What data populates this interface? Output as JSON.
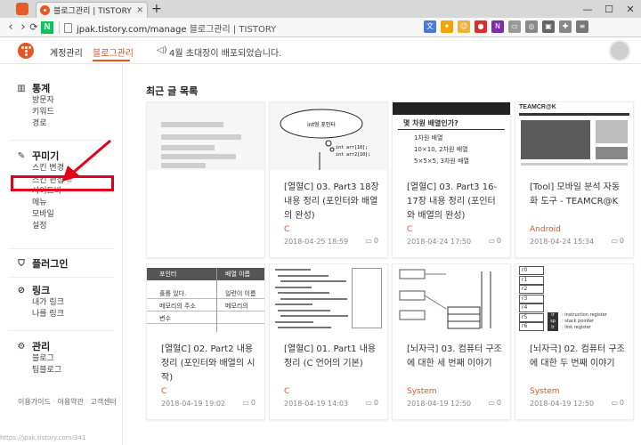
{
  "browser": {
    "tab_title": "블로그관리 | TISTORY",
    "tab_close": "✕",
    "new_tab": "+",
    "window_controls": [
      "—",
      "☐",
      "✕"
    ],
    "back": "‹",
    "forward": "›",
    "reload": "⟳",
    "naver_letter": "N",
    "url_domain": "jpak.tistory.com/manage",
    "url_title": "블로그관리 | TISTORY",
    "toolbar_icons": [
      {
        "name": "translate-icon",
        "color": "#4a79d8",
        "glyph": "文"
      },
      {
        "name": "keep-icon",
        "color": "#f2a600",
        "glyph": "✦"
      },
      {
        "name": "emoji-icon",
        "color": "#e8b53a",
        "glyph": "☺"
      },
      {
        "name": "adblock-icon",
        "color": "#d9302c",
        "glyph": "●"
      },
      {
        "name": "onenote-icon",
        "color": "#7b2fa0",
        "glyph": "N"
      },
      {
        "name": "pocket-icon",
        "color": "#999999",
        "glyph": "▭"
      },
      {
        "name": "capture-icon",
        "color": "#888888",
        "glyph": "◎"
      },
      {
        "name": "clip-icon",
        "color": "#666666",
        "glyph": "▣"
      },
      {
        "name": "puzzle-icon",
        "color": "#888888",
        "glyph": "✚"
      },
      {
        "name": "menu-icon",
        "color": "#777777",
        "glyph": "≡"
      }
    ]
  },
  "header": {
    "nav": [
      "계정관리",
      "블로그관리"
    ],
    "notice_icon": "◁)",
    "notice": "4월 초대장이 배포되었습니다."
  },
  "sidebar": {
    "groups": [
      {
        "icon": "chart-icon",
        "glyph": "▥",
        "title": "통계",
        "items": [
          "방문자",
          "키워드",
          "경로"
        ]
      },
      {
        "icon": "brush-icon",
        "glyph": "✎",
        "title": "꾸미기",
        "items": [
          "스킨 변경",
          "스킨 편집",
          "사이드바",
          "메뉴",
          "모바일",
          "설정"
        ]
      },
      {
        "icon": "plugin-icon",
        "glyph": "⛉",
        "title": "플러그인",
        "items": []
      },
      {
        "icon": "link-icon",
        "glyph": "⊘",
        "title": "링크",
        "items": [
          "내가 링크",
          "나를 링크"
        ]
      },
      {
        "icon": "settings-icon",
        "glyph": "⚙",
        "title": "관리",
        "items": [
          "블로그",
          "팀블로그"
        ]
      }
    ],
    "external_mark": "⧉",
    "footer": [
      "이용가이드",
      "이용약관",
      "고객센터"
    ]
  },
  "main": {
    "section_title": "최근 글 목록",
    "cards": [
      {
        "title": "",
        "category": "",
        "date": "",
        "comments": "",
        "thumb": "blur"
      },
      {
        "title": "[열혈C] 03. Part3 18장 내용 정리 (포인터와 배열의 완성)",
        "category": "C",
        "date": "2018-04-25 18:59",
        "comments": "0",
        "thumb": "cloud"
      },
      {
        "title": "[열혈C] 03. Part3 16-17장 내용 정리 (포인터와 배열의 완성)",
        "category": "C",
        "date": "2018-04-24 17:50",
        "comments": "0",
        "thumb": "array"
      },
      {
        "title": "[Tool] 모바일 분석 자동화 도구 - TEAMCR@K",
        "category": "Android",
        "date": "2018-04-24 15:34",
        "comments": "0",
        "thumb": "teamcrak"
      },
      {
        "title": "[열혈C] 02. Part2 내용 정리 (포인터와 배열의 시작)",
        "category": "C",
        "date": "2018-04-19 19:02",
        "comments": "0",
        "thumb": "table"
      },
      {
        "title": "[열혈C] 01. Part1 내용 정리 (C 언어의 기본)",
        "category": "C",
        "date": "2018-04-19 14:03",
        "comments": "0",
        "thumb": "code"
      },
      {
        "title": "[뇌자극] 03. 컴퓨터 구조에 대한 세 번째 이야기",
        "category": "System",
        "date": "2018-04-19 12:50",
        "comments": "0",
        "thumb": "diagram"
      },
      {
        "title": "[뇌자극] 02. 컴퓨터 구조에 대한 두 번째 이야기",
        "category": "System",
        "date": "2018-04-19 12:50",
        "comments": "0",
        "thumb": "registers"
      }
    ],
    "comment_icon": "▭"
  },
  "thumbs": {
    "cloud_main": "int형 포인터",
    "cloud_sub1": "int arr[10];",
    "cloud_sub2": "int arr2[10];",
    "array_title": "몇 차원 배열인가?",
    "array_rows": [
      "1차원 배열",
      "10×10, 2차원 배열",
      "5×5×5, 3차원 배열"
    ],
    "teamcrak_logo": "TEAMCR@K",
    "table_head": [
      "포인터",
      "배열 이름"
    ],
    "table_rows": [
      [
        "훌륭 있다.",
        "일련이 이름"
      ],
      [
        "메모리의 주소",
        "메모리의"
      ],
      [
        "변수",
        ""
      ]
    ],
    "reg_labels": [
      "r0",
      "r1",
      "r2",
      "r3",
      "r4",
      "r5",
      "r6"
    ],
    "reg_right": [
      "ir",
      "sp",
      "lr"
    ],
    "reg_notes": [
      ": instruction register",
      ": stack pointer",
      ": link register"
    ],
    "status_url": "https://jpak.tistory.com/341"
  }
}
